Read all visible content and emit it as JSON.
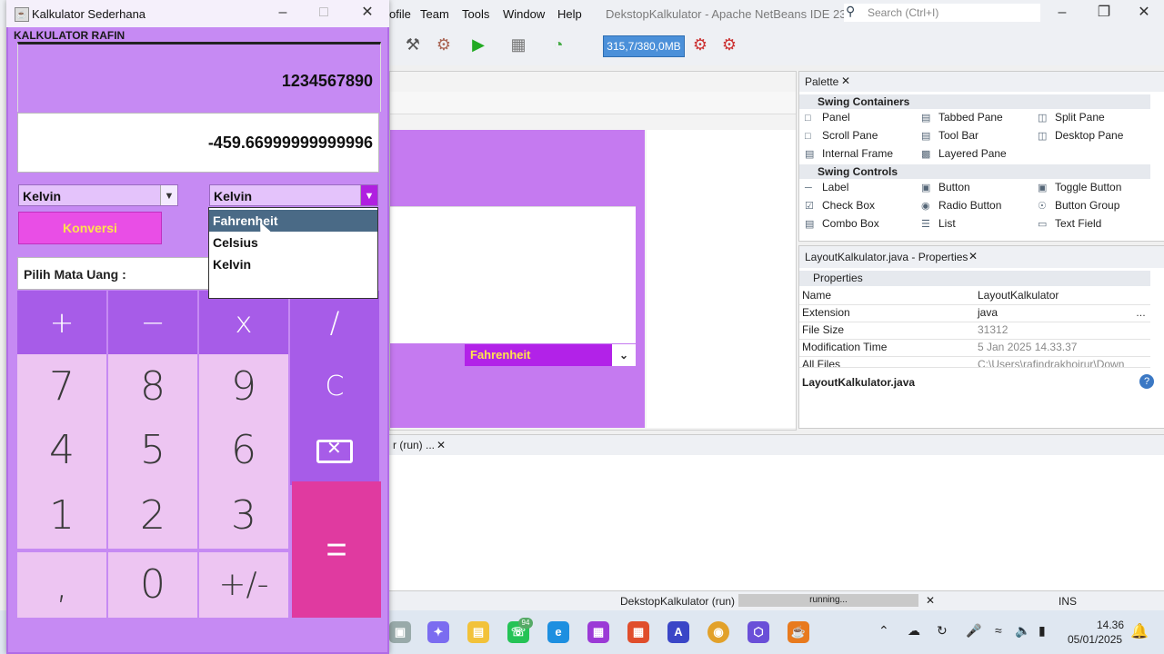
{
  "netbeans": {
    "menu": [
      "ofile",
      "Team",
      "Tools",
      "Window",
      "Help"
    ],
    "window_title": "DekstopKalkulator - Apache NetBeans IDE 23",
    "search_placeholder": "Search (Ctrl+I)",
    "memory": "315,7/380,0MB",
    "output_tab": "r (run) ...",
    "designer_fahrenheit": "Fahrenheit",
    "palette": {
      "title": "Palette",
      "sections": [
        {
          "name": "Swing Containers",
          "items": [
            "Panel",
            "Tabbed Pane",
            "Split Pane",
            "Scroll Pane",
            "Tool Bar",
            "Desktop Pane",
            "Internal Frame",
            "Layered Pane"
          ]
        },
        {
          "name": "Swing Controls",
          "items": [
            "Label",
            "Button",
            "Toggle Button",
            "Check Box",
            "Radio Button",
            "Button Group",
            "Combo Box",
            "List",
            "Text Field"
          ]
        }
      ]
    },
    "properties": {
      "title": "LayoutKalkulator.java - Properties",
      "section": "Properties",
      "rows": [
        {
          "key": "Name",
          "value": "LayoutKalkulator"
        },
        {
          "key": "Extension",
          "value": "java"
        },
        {
          "key": "File Size",
          "value": "31312"
        },
        {
          "key": "Modification Time",
          "value": "5 Jan 2025 14.33.37"
        },
        {
          "key": "All Files",
          "value": "C:\\Users\\rafindrakhoirur\\Down"
        }
      ],
      "footer": "LayoutKalkulator.java"
    },
    "status": {
      "project": "DekstopKalkulator (run)",
      "progress": "running...",
      "mode": "INS"
    }
  },
  "taskbar": {
    "time": "14.36",
    "date": "05/01/2025",
    "badge": "94"
  },
  "calculator": {
    "window_title": "Kalkulator Sederhana",
    "header": "KALKULATOR RAFIN",
    "display_input": "1234567890",
    "display_result": "-459.66999999999996",
    "from_unit": "Kelvin",
    "to_unit": "Kelvin",
    "convert_label": "Konversi",
    "currency_label": "Pilih Mata Uang :",
    "dropdown_options": [
      "Fahrenheit",
      "Celsius",
      "Kelvin"
    ],
    "keys": {
      "plus": "+",
      "minus": "−",
      "times": "x",
      "divide": "/",
      "seven": "7",
      "eight": "8",
      "nine": "9",
      "clear": "C",
      "four": "4",
      "five": "5",
      "six": "6",
      "one": "1",
      "two": "2",
      "three": "3",
      "equals": "=",
      "comma": ",",
      "zero": "0",
      "negate": "+/-"
    }
  }
}
